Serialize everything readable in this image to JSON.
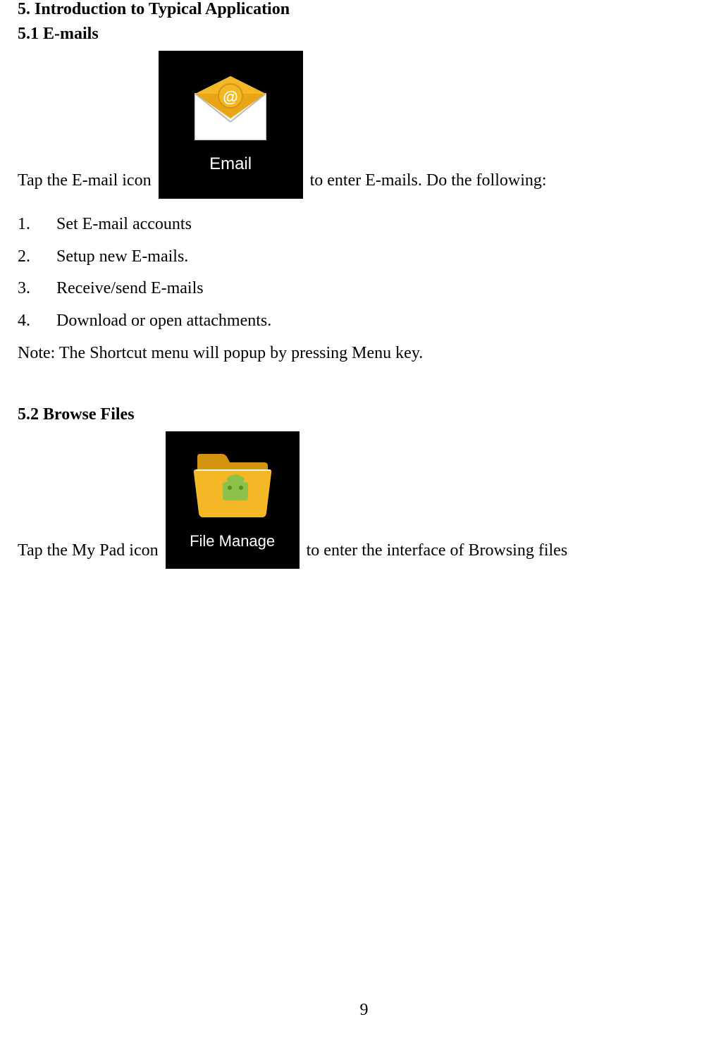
{
  "section5": {
    "title": "5. Introduction to Typical Application",
    "sub1": {
      "title": "5.1 E-mails",
      "para_before": "Tap the E-mail icon",
      "icon_label": "Email",
      "para_after": "to enter E-mails. Do the following:",
      "list": [
        "Set E-mail accounts",
        "Setup new E-mails.",
        "Receive/send E-mails",
        "Download or open attachments."
      ],
      "note": "Note: The Shortcut menu will popup by pressing Menu key."
    },
    "sub2": {
      "title": "5.2 Browse Files",
      "para_before": "Tap the My Pad    icon",
      "icon_label": "File Manage",
      "para_after": "to enter the interface of Browsing files"
    }
  },
  "page_number": "9"
}
